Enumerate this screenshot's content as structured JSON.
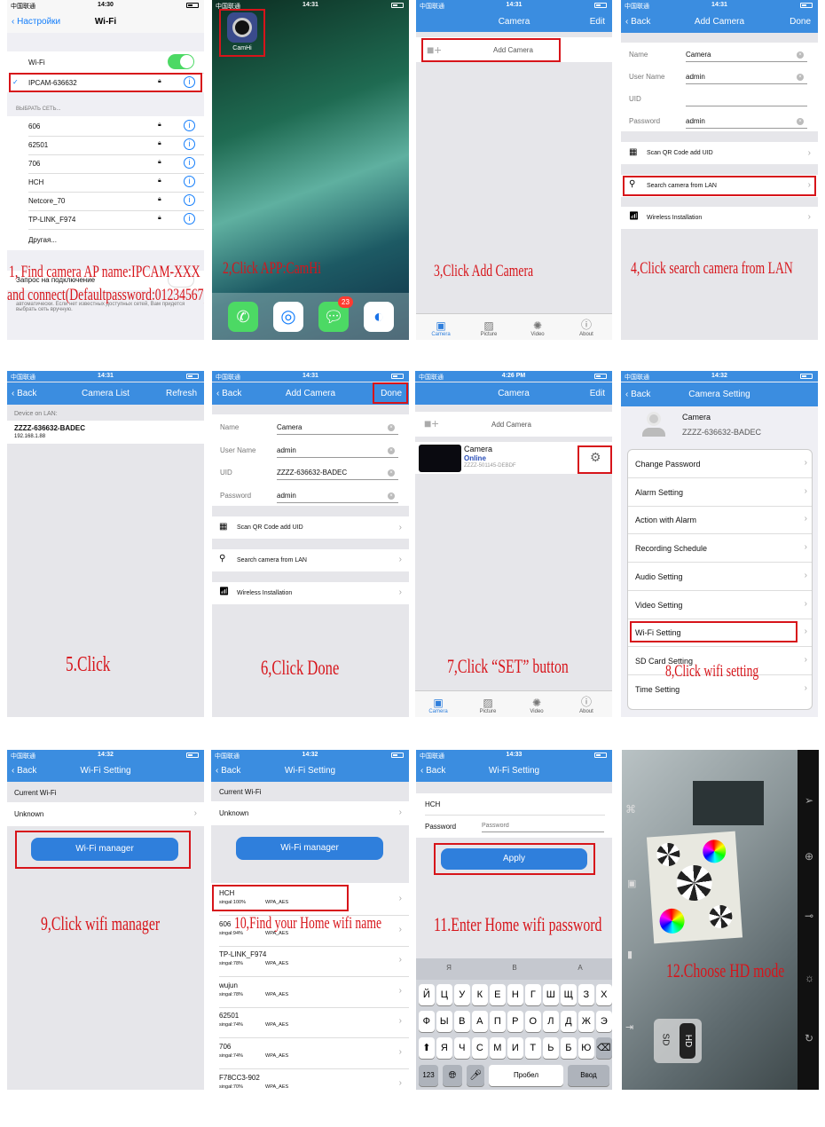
{
  "carrier": "中国联通",
  "p1": {
    "time": "14:30",
    "back": "Настройки",
    "title": "Wi-Fi",
    "wifi_label": "Wi-Fi",
    "connected": "IPCAM-636632",
    "section": "ВЫБРАТЬ СЕТЬ...",
    "networks": [
      "606",
      "62501",
      "706",
      "HCH",
      "Netcore_70",
      "TP-LINK_F974"
    ],
    "other": "Другая...",
    "ask": "Запрос на подключение",
    "desc": "автоматически. Если нет известных доступных сетей, Вам придется выбрать сеть вручную.",
    "caption1": "1, Find camera AP name:IPCAM-XXX",
    "caption2": "and connect(Defaultpassword:01234567)"
  },
  "p2": {
    "time": "14:31",
    "app": "CamHi",
    "badge": "23",
    "caption": "2,Click APP:CamHi"
  },
  "p3": {
    "time": "14:31",
    "title": "Camera",
    "edit": "Edit",
    "add": "Add Camera",
    "caption": "3,Click Add Camera",
    "tabs": [
      "Camera",
      "Picture",
      "Video",
      "About"
    ]
  },
  "p4": {
    "time": "14:31",
    "back": "Back",
    "title": "Add Camera",
    "done": "Done",
    "fields": [
      {
        "label": "Name",
        "value": "Camera"
      },
      {
        "label": "User Name",
        "value": "admin"
      },
      {
        "label": "UID",
        "value": ""
      },
      {
        "label": "Password",
        "value": "admin"
      }
    ],
    "scan": "Scan QR Code add UID",
    "search": "Search camera from LAN",
    "wireless": "Wireless Installation",
    "caption": "4,Click search camera from LAN"
  },
  "p5": {
    "time": "14:31",
    "back": "Back",
    "title": "Camera List",
    "refresh": "Refresh",
    "section": "Device on LAN:",
    "device": "ZZZZ-636632-BADEC",
    "ip": "192.168.1.88",
    "caption": "5.Click"
  },
  "p6": {
    "time": "14:31",
    "back": "Back",
    "title": "Add Camera",
    "done": "Done",
    "fields": [
      {
        "label": "Name",
        "value": "Camera"
      },
      {
        "label": "User Name",
        "value": "admin"
      },
      {
        "label": "UID",
        "value": "ZZZZ-636632-BADEC"
      },
      {
        "label": "Password",
        "value": "admin"
      }
    ],
    "scan": "Scan QR Code add UID",
    "search": "Search camera from LAN",
    "wireless": "Wireless Installation",
    "caption": "6,Click Done"
  },
  "p7": {
    "time": "4:26 PM",
    "title": "Camera",
    "edit": "Edit",
    "add": "Add Camera",
    "cam_name": "Camera",
    "cam_status": "Online",
    "cam_uid": "ZZZZ-501145-DEBDF",
    "caption": "7,Click  “SET” button",
    "tabs": [
      "Camera",
      "Picture",
      "Video",
      "About"
    ]
  },
  "p8": {
    "time": "14:32",
    "back": "Back",
    "title": "Camera Setting",
    "cam_name": "Camera",
    "cam_uid": "ZZZZ-636632-BADEC",
    "items": [
      "Change Password",
      "Alarm Setting",
      "Action with Alarm",
      "Recording Schedule",
      "Audio Setting",
      "Video Setting",
      "Wi-Fi Setting",
      "SD Card Setting",
      "Time Setting"
    ],
    "caption": "8,Click wifi setting"
  },
  "p9": {
    "time": "14:32",
    "back": "Back",
    "title": "Wi-Fi Setting",
    "current": "Current Wi-Fi",
    "unknown": "Unknown",
    "manager": "Wi-Fi manager",
    "caption": "9,Click wifi manager"
  },
  "p10": {
    "time": "14:32",
    "back": "Back",
    "title": "Wi-Fi Setting",
    "current": "Current Wi-Fi",
    "unknown": "Unknown",
    "manager": "Wi-Fi manager",
    "networks": [
      {
        "name": "HCH",
        "signal": "singal:100%",
        "sec": "WPA_AES"
      },
      {
        "name": "606",
        "signal": "singal:94%",
        "sec": "WPA_AES"
      },
      {
        "name": "TP-LINK_F974",
        "signal": "singal:78%",
        "sec": "WPA_AES"
      },
      {
        "name": "wujun",
        "signal": "singal:78%",
        "sec": "WPA_AES"
      },
      {
        "name": "62501",
        "signal": "singal:74%",
        "sec": "WPA_AES"
      },
      {
        "name": "706",
        "signal": "singal:74%",
        "sec": "WPA_AES"
      },
      {
        "name": "F78CC3-902",
        "signal": "singal:70%",
        "sec": "WPA_AES"
      }
    ],
    "caption": "10,Find your Home wifi name"
  },
  "p11": {
    "time": "14:33",
    "back": "Back",
    "title": "Wi-Fi Setting",
    "ssid": "HCH",
    "pw_label": "Password",
    "pw_placeholder": "Password",
    "apply": "Apply",
    "caption": "11.Enter Home wifi password",
    "suggest": [
      "Я",
      "В",
      "А"
    ],
    "row1": [
      "Й",
      "Ц",
      "У",
      "К",
      "Е",
      "Н",
      "Г",
      "Ш",
      "Щ",
      "З",
      "Х"
    ],
    "row2": [
      "Ф",
      "Ы",
      "В",
      "А",
      "П",
      "Р",
      "О",
      "Л",
      "Д",
      "Ж",
      "Э"
    ],
    "row3": [
      "Я",
      "Ч",
      "С",
      "М",
      "И",
      "Т",
      "Ь",
      "Б",
      "Ю"
    ],
    "k123": "123",
    "space": "Пробел",
    "enter": "Ввод"
  },
  "p12": {
    "sd": "SD",
    "hd": "HD",
    "caption": "12.Choose HD mode"
  }
}
